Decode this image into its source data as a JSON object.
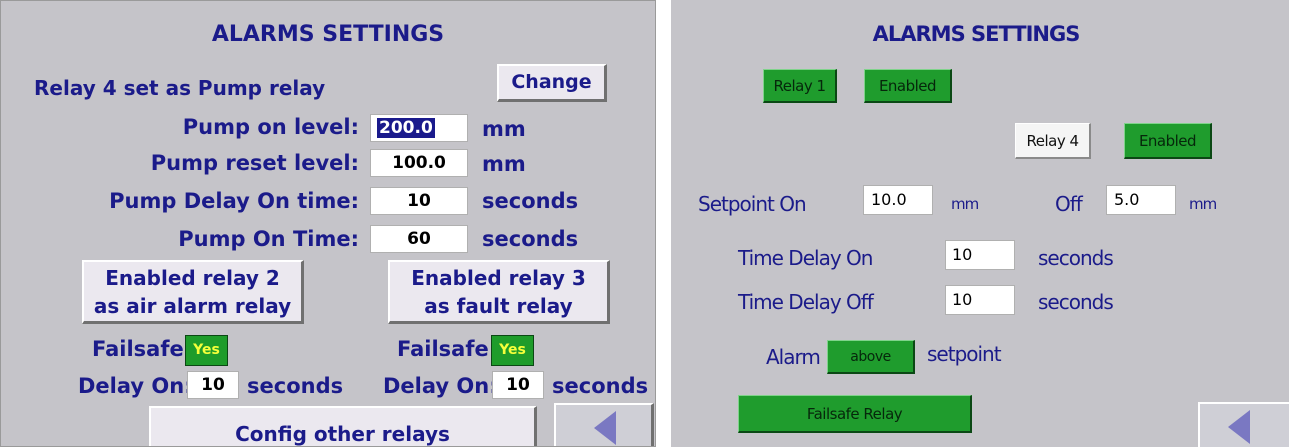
{
  "left_panel": {
    "title": "ALARMS SETTINGS",
    "relay4_label": "Relay 4 set as  Pump relay",
    "change_button": "Change",
    "rows": [
      {
        "label": "Pump on level:",
        "value": "200.0",
        "unit": "mm"
      },
      {
        "label": "Pump reset level:",
        "value": "100.0",
        "unit": "mm"
      },
      {
        "label": "Pump Delay On time:",
        "value": "10",
        "unit": "seconds"
      },
      {
        "label": "Pump On Time:",
        "value": "60",
        "unit": "seconds"
      }
    ],
    "relay2_button": {
      "line1": "Enabled relay 2",
      "line2": "as air alarm relay"
    },
    "relay3_button": {
      "line1": "Enabled relay 3",
      "line2": "as fault relay"
    },
    "failsafe_label": "Failsafe",
    "failsafe_left": "Yes",
    "failsafe_right": "Yes",
    "delay_on_label": "Delay On:",
    "delay_left_value": "10",
    "delay_right_value": "10",
    "delay_unit": "seconds",
    "config_button": "Config other relays"
  },
  "right_panel": {
    "title": "ALARMS SETTINGS",
    "relay1_button": "Relay 1",
    "relay1_state": "Enabled",
    "relay4_button": "Relay 4",
    "relay4_state": "Enabled",
    "setpoint_on_label": "Setpoint On",
    "setpoint_on_value": "10.0",
    "setpoint_unit": "mm",
    "off_label": "Off",
    "off_value": "5.0",
    "time_delay_on_label": "Time Delay On",
    "time_delay_on_value": "10",
    "time_delay_off_label": "Time Delay Off",
    "time_delay_off_value": "10",
    "seconds_unit": "seconds",
    "alarm_label": "Alarm",
    "alarm_mode": "above",
    "setpoint_word": "setpoint",
    "failsafe_button": "Failsafe Relay"
  },
  "colors": {
    "panel_bg": "#c5c4c9",
    "text": "#1b1b8a",
    "green": "#1f9c2d",
    "back_arrow": "#7a78c2"
  },
  "icons": {
    "back": "left-triangle-icon"
  }
}
